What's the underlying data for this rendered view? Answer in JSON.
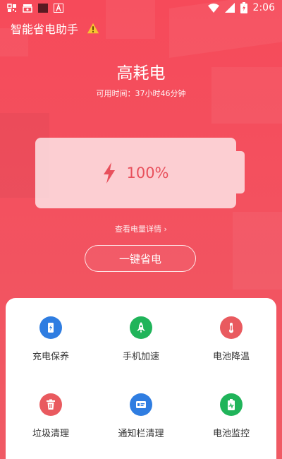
{
  "status_bar": {
    "time": "2:06",
    "left_icons": [
      "qr-icon",
      "cast-icon",
      "square-icon",
      "a-icon"
    ],
    "right_icons": [
      "wifi-icon",
      "signal-icon",
      "battery-charging-icon"
    ]
  },
  "app": {
    "title": "智能省电助手",
    "warning_icon": "warning-icon"
  },
  "battery": {
    "mode": "高耗电",
    "remaining_time": "可用时间：37小时46分钟",
    "level_text": "100%",
    "level_fraction": 1.0,
    "details_link": "查看电量详情 ›"
  },
  "one_key_button": "一键省电",
  "tools": [
    {
      "label": "充电保养",
      "icon": "phone-charge-icon",
      "color": "#2f7de1"
    },
    {
      "label": "手机加速",
      "icon": "rocket-icon",
      "color": "#20b45a"
    },
    {
      "label": "电池降温",
      "icon": "thermometer-icon",
      "color": "#e95a5f"
    },
    {
      "label": "垃圾清理",
      "icon": "trash-icon",
      "color": "#e95a5f"
    },
    {
      "label": "通知栏清理",
      "icon": "notification-card-icon",
      "color": "#2f7de1"
    },
    {
      "label": "电池监控",
      "icon": "battery-monitor-icon",
      "color": "#20b45a"
    }
  ],
  "colors": {
    "background": "#f64a5a",
    "accent_red": "#e8505c",
    "panel": "#ffffff"
  }
}
